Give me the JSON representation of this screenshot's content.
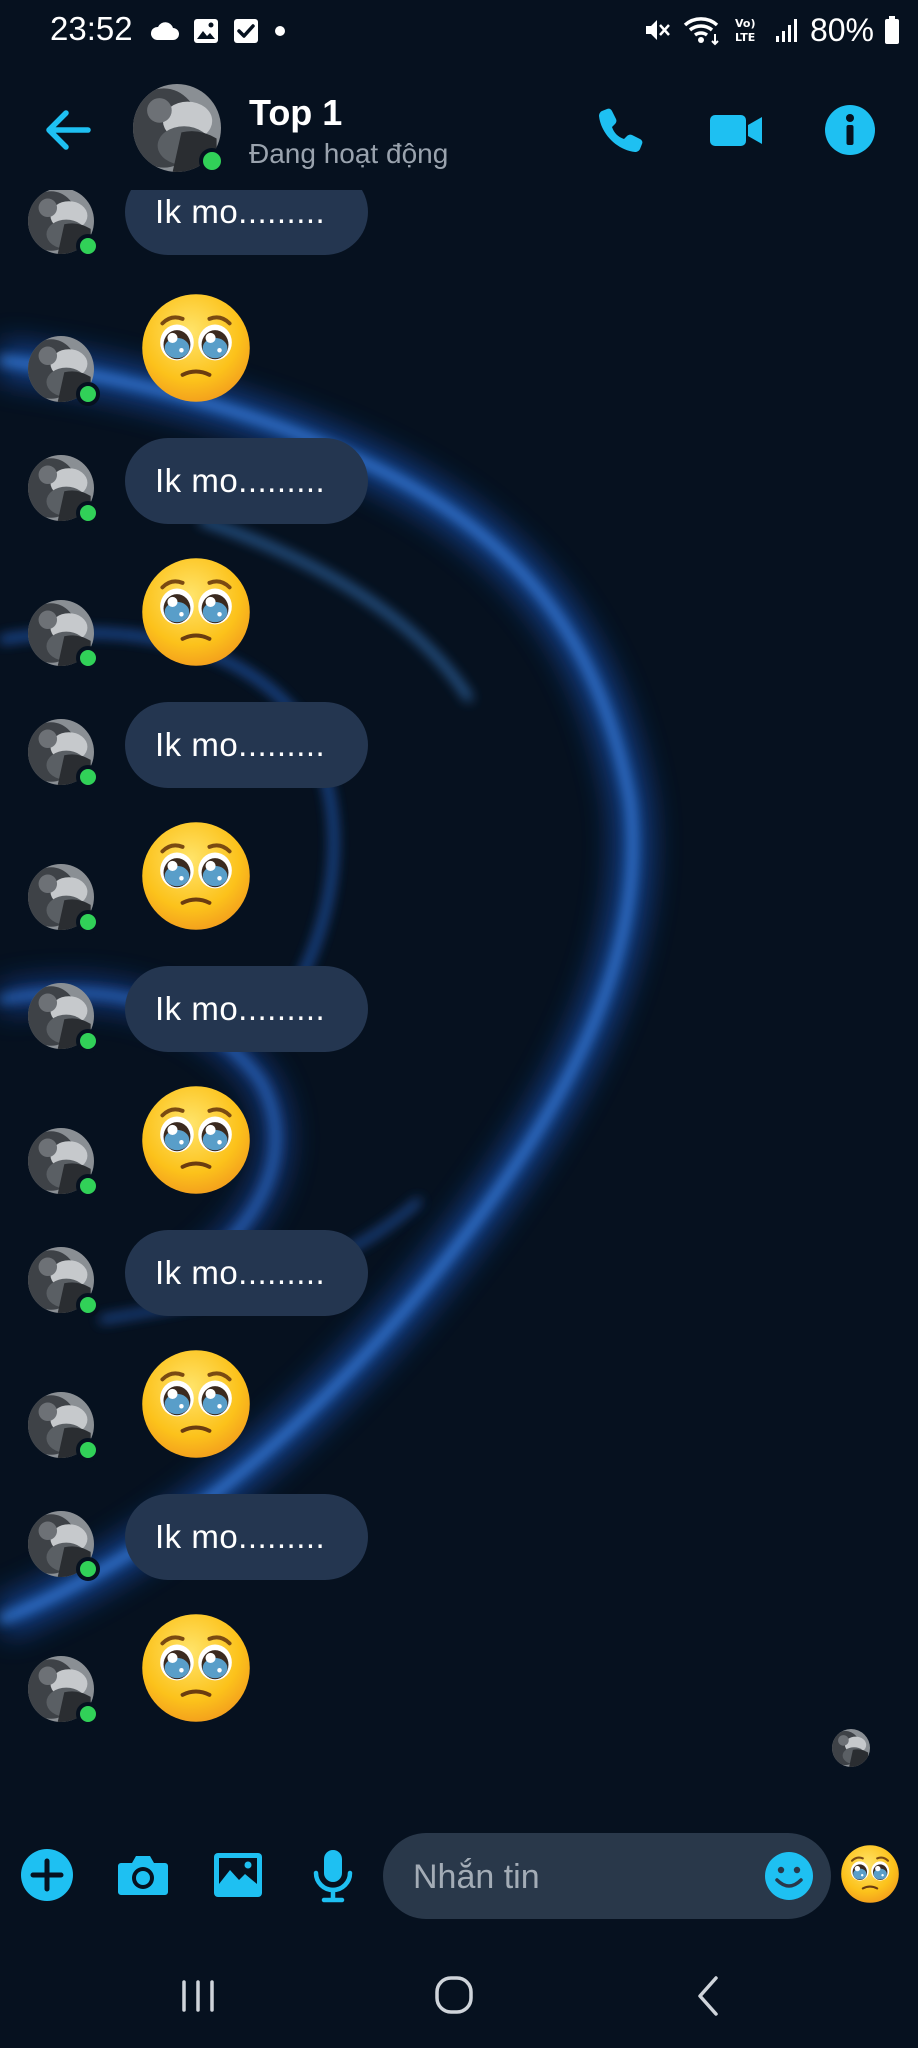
{
  "status_bar": {
    "time": "23:52",
    "battery": "80%",
    "network": "VoLTE",
    "left_icons": [
      "cloud-icon",
      "gallery-icon",
      "checkbox-icon",
      "dot-icon"
    ],
    "right_icons": [
      "mute-icon",
      "wifi-icon",
      "volte-icon",
      "signal-icon",
      "battery-icon"
    ]
  },
  "header": {
    "contact_name": "Top 1",
    "contact_status": "Đang hoạt động",
    "icons": [
      "back-arrow-icon",
      "phone-icon",
      "video-icon",
      "info-icon"
    ]
  },
  "messages": [
    {
      "type": "text",
      "text": "Ik mo........."
    },
    {
      "type": "emoji",
      "emoji": "pleading-face-icon"
    },
    {
      "type": "text",
      "text": "Ik mo........."
    },
    {
      "type": "emoji",
      "emoji": "pleading-face-icon"
    },
    {
      "type": "text",
      "text": "Ik mo........."
    },
    {
      "type": "emoji",
      "emoji": "pleading-face-icon"
    },
    {
      "type": "text",
      "text": "Ik mo........."
    },
    {
      "type": "emoji",
      "emoji": "pleading-face-icon"
    },
    {
      "type": "text",
      "text": "Ik mo........."
    },
    {
      "type": "emoji",
      "emoji": "pleading-face-icon"
    },
    {
      "type": "text",
      "text": "Ik mo........."
    },
    {
      "type": "emoji",
      "emoji": "pleading-face-icon"
    }
  ],
  "composer": {
    "placeholder": "Nhắn tin",
    "value": "",
    "icons": [
      "plus-icon",
      "camera-icon",
      "image-icon",
      "microphone-icon",
      "smiley-icon",
      "pleading-face-icon"
    ]
  },
  "nav_bar": {
    "icons": [
      "recent-apps-icon",
      "home-icon",
      "back-icon"
    ]
  },
  "colors": {
    "accent": "#1ec0f2",
    "background": "#06111f",
    "bubble": "#243650",
    "online": "#31d158",
    "input": "#29384a"
  }
}
